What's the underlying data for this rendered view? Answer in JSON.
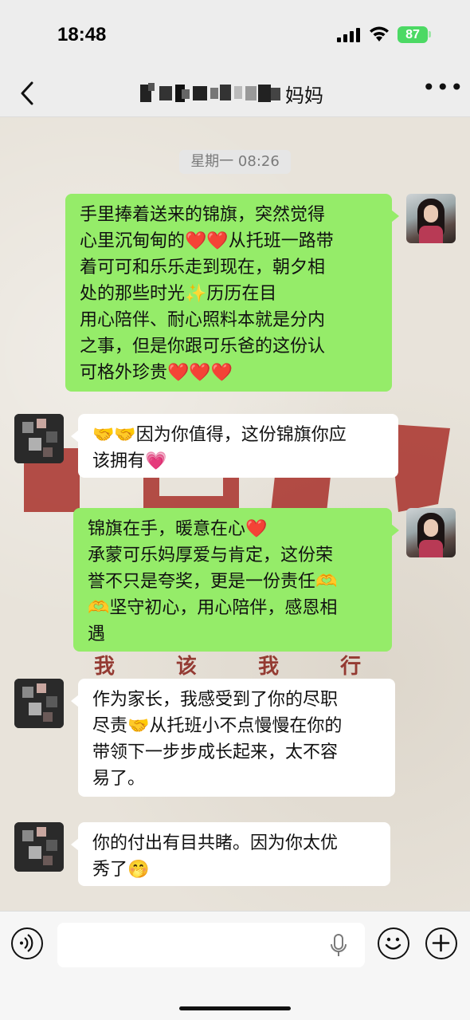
{
  "status_bar": {
    "time": "18:48",
    "battery": "87",
    "icons": [
      "signal-icon",
      "wifi-icon",
      "battery-icon"
    ]
  },
  "nav": {
    "title_visible": "妈妈",
    "icons": [
      "back-arrow-icon",
      "more-dots-icon"
    ]
  },
  "chat": {
    "timestamp": "星期一 08:26",
    "background": {
      "slogan": "我 该 我 行 报 祖 国"
    },
    "messages": [
      {
        "side": "right",
        "lines": [
          "手里捧着送来的锦旗，突然觉得",
          "心里沉甸甸的❤️❤️从托班一路带",
          "着可可和乐乐走到现在，朝夕相",
          "处的那些时光✨历历在目",
          "用心陪伴、耐心照料本就是分内",
          "之事，但是你跟可乐爸的这份认",
          "可格外珍贵❤️❤️❤️"
        ]
      },
      {
        "side": "left",
        "lines": [
          "🤝🤝因为你值得，这份锦旗你应",
          "该拥有💗"
        ]
      },
      {
        "side": "right",
        "lines": [
          "锦旗在手，暖意在心❤️",
          "承蒙可乐妈厚爱与肯定，这份荣",
          "誉不只是夸奖，更是一份责任🫶",
          "🫶坚守初心，用心陪伴，感恩相",
          "遇"
        ]
      },
      {
        "side": "left",
        "lines": [
          "作为家长，我感受到了你的尽职",
          "尽责🤝从托班小不点慢慢在你的",
          "带领下一步步成长起来，太不容",
          "易了。"
        ]
      },
      {
        "side": "left",
        "lines": [
          "你的付出有目共睹。因为你太优",
          "秀了🤭"
        ]
      }
    ]
  },
  "colors": {
    "self_bubble": "#95ec69",
    "other_bubble": "#ffffff",
    "nav_bg": "#ededed",
    "banner_red": "#a8302a"
  },
  "input_bar": {
    "placeholder": "",
    "icons": [
      "voice-icon",
      "mic-icon",
      "emoji-icon",
      "plus-icon"
    ]
  }
}
